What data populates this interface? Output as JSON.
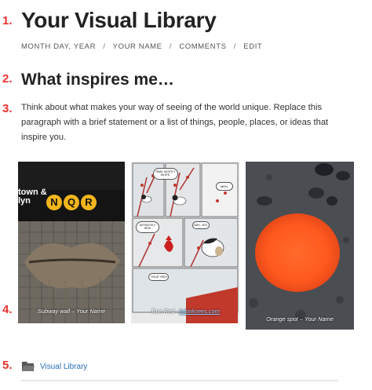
{
  "markers": [
    "1.",
    "2.",
    "3.",
    "4.",
    "5."
  ],
  "post": {
    "title": "Your Visual Library",
    "meta": {
      "date": "MONTH DAY, YEAR",
      "author": "YOUR NAME",
      "comments": "COMMENTS",
      "edit": "EDIT",
      "separator": "/"
    },
    "heading": "What inspires me…",
    "paragraph": "Think about what makes your way of seeing of the world unique. Replace this paragraph with a brief statement or a list of things, people, places, or ideas that inspire you."
  },
  "gallery": {
    "subway": {
      "caption": "Subway wall – Your Name",
      "sign": {
        "station_lines": "town &",
        "station_sub": "lyn",
        "letters": [
          "N",
          "Q",
          "R"
        ]
      }
    },
    "comic": {
      "caption_prefix": "True Red –",
      "caption_link": "falseknees.com",
      "bubbles": [
        "HMM. MOSTLY WHITE.",
        "MEH.",
        "DEFINITELY RED!",
        "NAH. YES.",
        "\"TRUE\" RED!"
      ]
    },
    "orange": {
      "caption": "Orange spot – Your Name"
    }
  },
  "category": {
    "icon": "folder-icon",
    "label": "Visual Library"
  },
  "colors": {
    "marker_red": "#e8322d",
    "link_blue": "#2a6ebb",
    "orange_spot": "#ff5a1f",
    "sign_yellow": "#f2b51c"
  }
}
